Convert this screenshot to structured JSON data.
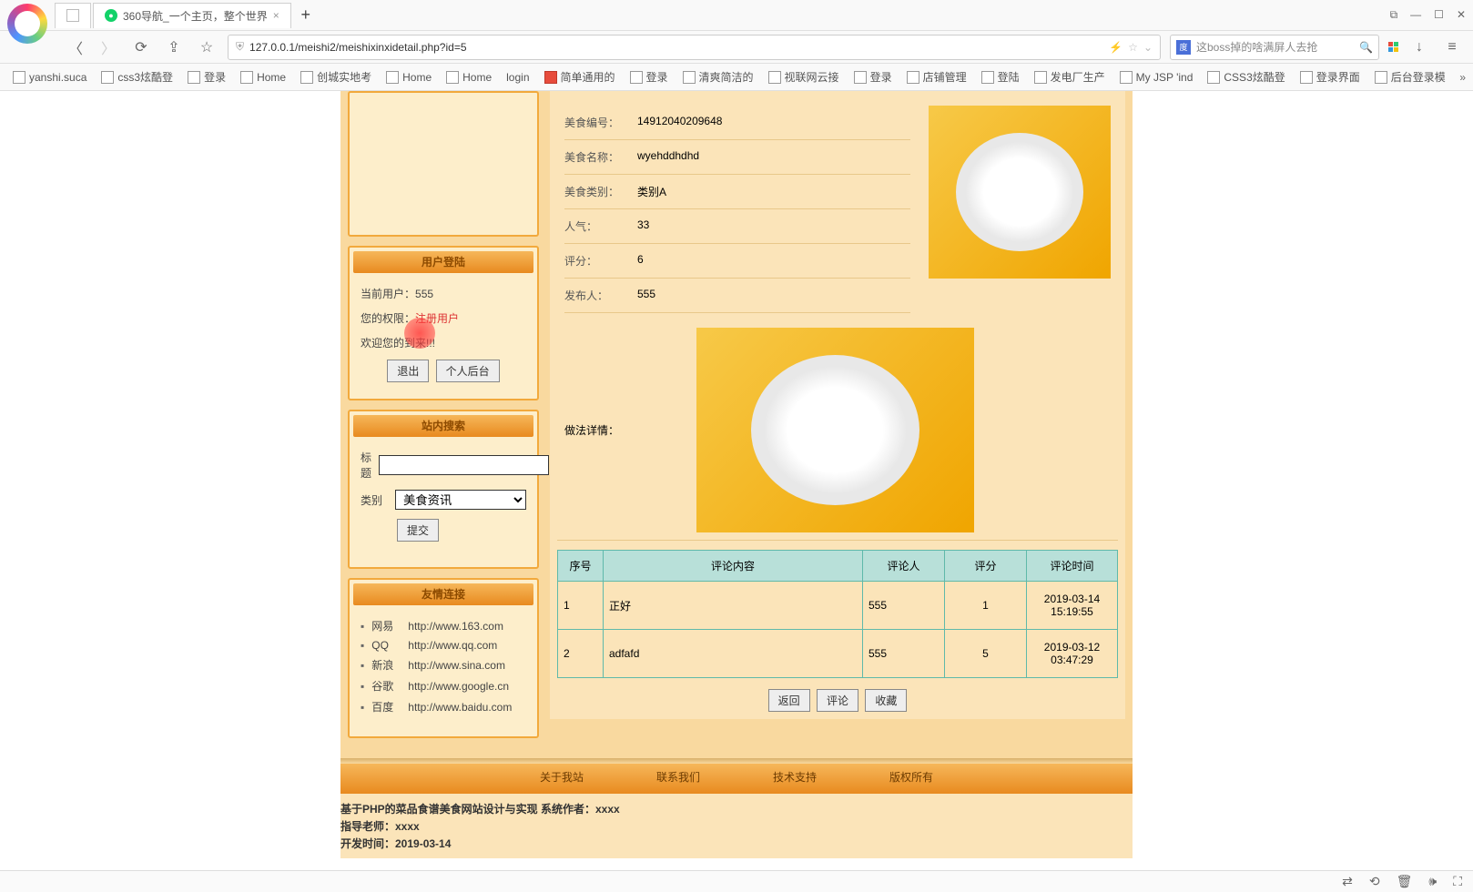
{
  "browser": {
    "tabs": [
      {
        "title": "",
        "favicon": "blank"
      },
      {
        "title": "360导航_一个主页，整个世界",
        "favicon": "360"
      }
    ],
    "url": "127.0.0.1/meishi2/meishixinxidetail.php?id=5",
    "search_placeholder": "这boss掉的啥满屏人去抢",
    "bookmarks": [
      "yanshi.suca",
      "css3炫酷登",
      "登录",
      "Home",
      "创城实地考",
      "Home",
      "Home",
      "login",
      "简单通用的",
      "登录",
      "清爽简洁的",
      "视联网云接",
      "登录",
      "店铺管理",
      "登陆",
      "发电厂生产",
      "My JSP 'ind",
      "CSS3炫酷登",
      "登录界面",
      "后台登录模"
    ]
  },
  "sidebar": {
    "login_panel": {
      "title": "用户登陆",
      "current_user_label": "当前用户：",
      "current_user": "555",
      "perm_label": "您的权限：",
      "perm_value": "注册用户",
      "welcome": "欢迎您的到来!!!",
      "logout_btn": "退出",
      "personal_btn": "个人后台"
    },
    "search_panel": {
      "title": "站内搜索",
      "title_label": "标题",
      "category_label": "类别",
      "category_value": "美食资讯",
      "submit": "提交"
    },
    "links_panel": {
      "title": "友情连接",
      "items": [
        {
          "name": "网易",
          "url": "http://www.163.com"
        },
        {
          "name": "QQ",
          "url": "http://www.qq.com"
        },
        {
          "name": "新浪",
          "url": "http://www.sina.com"
        },
        {
          "name": "谷歌",
          "url": "http://www.google.cn"
        },
        {
          "name": "百度",
          "url": "http://www.baidu.com"
        }
      ]
    }
  },
  "detail": {
    "fields": {
      "id_label": "美食编号：",
      "id": "14912040209648",
      "name_label": "美食名称：",
      "name": "wyehddhdhd",
      "cat_label": "美食类别：",
      "cat": "类别A",
      "pop_label": "人气：",
      "pop": "33",
      "score_label": "评分：",
      "score": "6",
      "pub_label": "发布人：",
      "pub": "555",
      "method_label": "做法详情："
    }
  },
  "comments": {
    "headers": [
      "序号",
      "评论内容",
      "评论人",
      "评分",
      "评论时间"
    ],
    "rows": [
      {
        "idx": "1",
        "content": "正好",
        "user": "555",
        "score": "1",
        "t1": "2019-03-14",
        "t2": "15:19:55"
      },
      {
        "idx": "2",
        "content": "adfafd",
        "user": "555",
        "score": "5",
        "t1": "2019-03-12",
        "t2": "03:47:29"
      }
    ]
  },
  "actions": {
    "back": "返回",
    "comment": "评论",
    "fav": "收藏"
  },
  "footer": {
    "links": [
      "关于我站",
      "联系我们",
      "技术支持",
      "版权所有"
    ],
    "line1": "基于PHP的菜品食谱美食网站设计与实现 系统作者：xxxx",
    "line2": "指导老师：xxxx",
    "line3": "开发时间：2019-03-14"
  }
}
